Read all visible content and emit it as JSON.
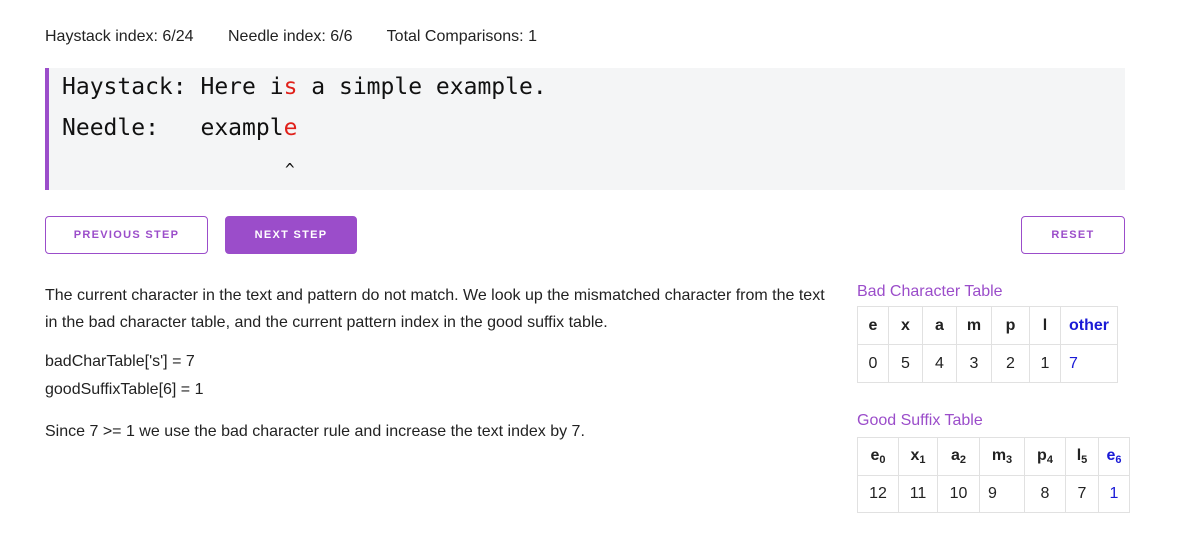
{
  "status": {
    "haystack_index": "Haystack index: 6/24",
    "needle_index": "Needle index: 6/6",
    "total_comparisons": "Total Comparisons: 1"
  },
  "code": {
    "haystack_label": "Haystack: ",
    "haystack_before": "Here i",
    "haystack_highlight": "s",
    "haystack_after": " a simple example.",
    "needle_label": "Needle:   ",
    "needle_before": "exampl",
    "needle_highlight": "e",
    "caret": "^"
  },
  "buttons": {
    "previous": "PREVIOUS STEP",
    "next": "NEXT STEP",
    "reset": "RESET"
  },
  "explanation": {
    "para1": "The current character in the text and pattern do not match. We look up the mismatched character from the text in the bad character table, and the current pattern index in the good suffix table.",
    "bad_char_lookup": "badCharTable['s'] = 7",
    "good_suffix_lookup": "goodSuffixTable[6] = 1",
    "conclusion": "Since 7 >= 1 we use the bad character rule and increase the text index by 7."
  },
  "bad_char_table": {
    "title": "Bad Character Table",
    "headers": [
      "e",
      "x",
      "a",
      "m",
      "p",
      "l",
      "other"
    ],
    "values": [
      "0",
      "5",
      "4",
      "3",
      "2",
      "1",
      "7"
    ]
  },
  "good_suffix_table": {
    "title": "Good Suffix Table",
    "headers": [
      {
        "char": "e",
        "sub": "0"
      },
      {
        "char": "x",
        "sub": "1"
      },
      {
        "char": "a",
        "sub": "2"
      },
      {
        "char": "m",
        "sub": "3"
      },
      {
        "char": "p",
        "sub": "4"
      },
      {
        "char": "l",
        "sub": "5"
      },
      {
        "char": "e",
        "sub": "6"
      }
    ],
    "values": [
      "12",
      "11",
      "10",
      "9",
      "8",
      "7",
      "1"
    ]
  },
  "colors": {
    "accent": "#9b4dca",
    "mismatch": "#e0201a",
    "highlight": "#1a1ad6"
  }
}
